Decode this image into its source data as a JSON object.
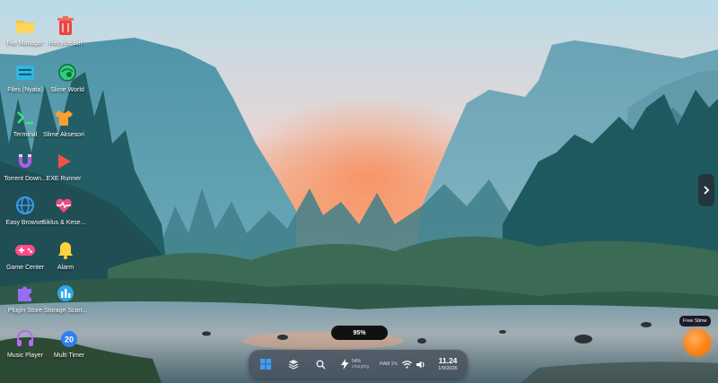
{
  "desktop": {
    "icons": [
      {
        "label": "File Manager",
        "icon": "folder-icon"
      },
      {
        "label": "Recycle Bin",
        "icon": "trash-icon"
      },
      {
        "label": "Files (Nyata)",
        "icon": "drive-icon"
      },
      {
        "label": "Slime World",
        "icon": "globe-slime-icon"
      },
      {
        "label": "Terminal",
        "icon": "terminal-icon"
      },
      {
        "label": "Slime Aksesori",
        "icon": "shirt-icon"
      },
      {
        "label": "Torrent Down...",
        "icon": "magnet-icon"
      },
      {
        "label": "EXE Runner",
        "icon": "play-icon"
      },
      {
        "label": "Easy Browser",
        "icon": "globe-icon"
      },
      {
        "label": "Siklus & Kese...",
        "icon": "heart-pulse-icon"
      },
      {
        "label": "Game Center",
        "icon": "gamepad-icon"
      },
      {
        "label": "Alarm",
        "icon": "bell-icon"
      },
      {
        "label": "Plugin Store",
        "icon": "puzzle-icon"
      },
      {
        "label": "Storage Scan...",
        "icon": "pie-chart-icon"
      },
      {
        "label": "Music Player",
        "icon": "headphones-icon"
      },
      {
        "label": "Multi Timer",
        "icon": "timer-icon"
      }
    ]
  },
  "progress": {
    "label": "95%",
    "value": 0.95
  },
  "taskbar": {
    "battery_percent": "54%",
    "battery_status": "charging",
    "ram_label": "RAM 1%",
    "time": "11.24",
    "date": "1/9/2026"
  },
  "slime": {
    "badge": "Free Slime"
  },
  "colors": {
    "sky_top": "#b9d8e6",
    "sunset": "#f6a07f",
    "orb": "#ff8a1e"
  }
}
